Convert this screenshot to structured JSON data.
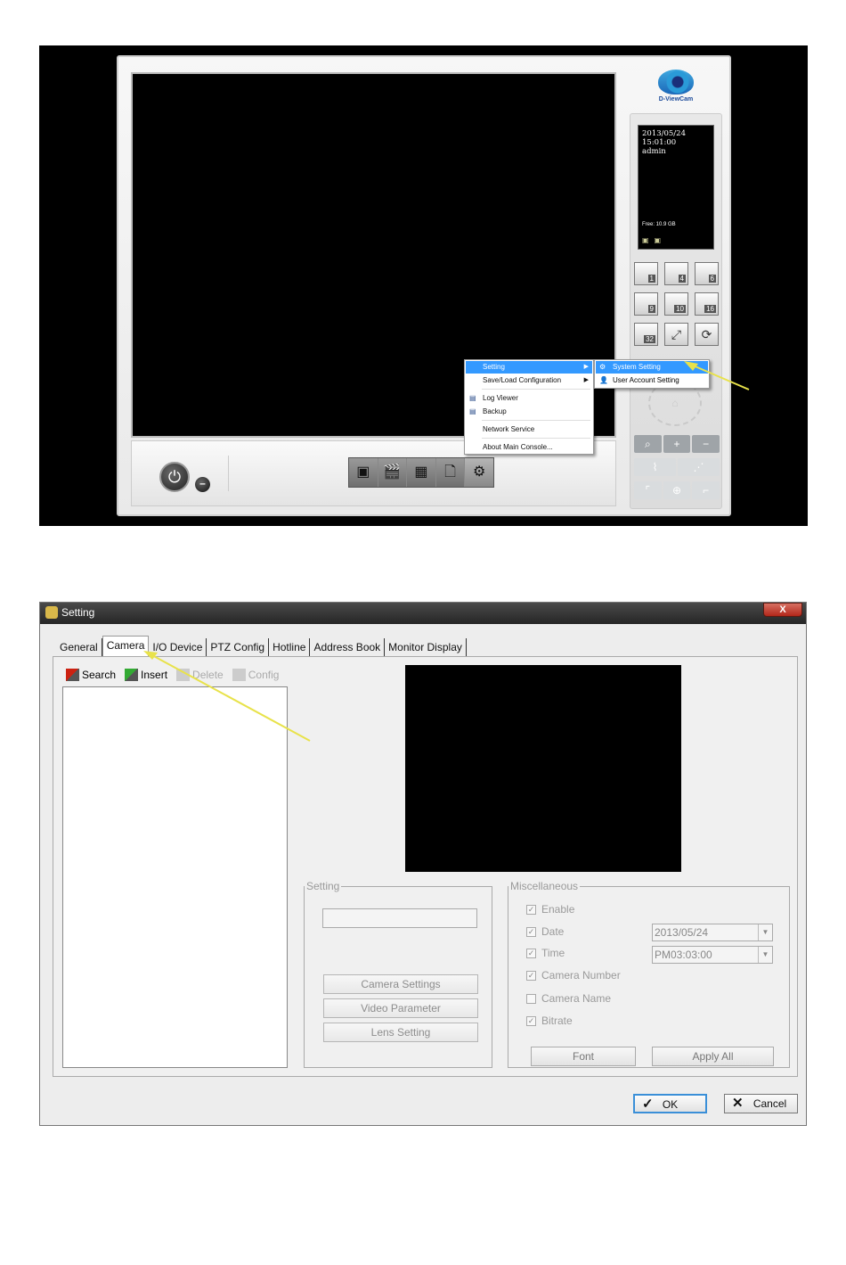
{
  "console": {
    "logo_text": "D-ViewCam",
    "info": {
      "date": "2013/05/24",
      "time": "15:01:00",
      "user": "admin",
      "free": "Free: 10.9 GB"
    },
    "grid_buttons": [
      "1",
      "4",
      "6",
      "9",
      "10",
      "16",
      "32",
      "",
      ""
    ],
    "power_icon": "⏻",
    "minimize_icon": "–",
    "toolbar_icons": [
      "▣",
      "🎬",
      "▦",
      "🗋",
      "⚙"
    ],
    "context_menu": {
      "items": [
        "Setting",
        "Save/Load Configuration",
        "Log Viewer",
        "Backup",
        "Network Service",
        "About Main Console..."
      ],
      "submenu": [
        "System Setting",
        "User Account Setting"
      ]
    }
  },
  "dialog": {
    "title": "Setting",
    "close_glyph": "X",
    "tabs": [
      "General",
      "Camera",
      "I/O Device",
      "PTZ Config",
      "Hotline",
      "Address Book",
      "Monitor Display"
    ],
    "active_tab": "Camera",
    "camera_toolbar": [
      "Search",
      "Insert",
      "Delete",
      "Config"
    ],
    "setting_group": {
      "legend": "Setting",
      "buttons": [
        "Camera Settings",
        "Video Parameter",
        "Lens Setting"
      ]
    },
    "misc_group": {
      "legend": "Miscellaneous",
      "checks": [
        {
          "label": "Enable",
          "checked": true
        },
        {
          "label": "Date",
          "checked": true
        },
        {
          "label": "Time",
          "checked": true
        },
        {
          "label": "Camera Number",
          "checked": true
        },
        {
          "label": "Camera Name",
          "checked": false
        },
        {
          "label": "Bitrate",
          "checked": true
        }
      ],
      "date_value": "2013/05/24",
      "time_value": "PM03:03:00",
      "font_button": "Font",
      "apply_all_button": "Apply All"
    },
    "ok_button": "OK",
    "cancel_button": "Cancel"
  }
}
